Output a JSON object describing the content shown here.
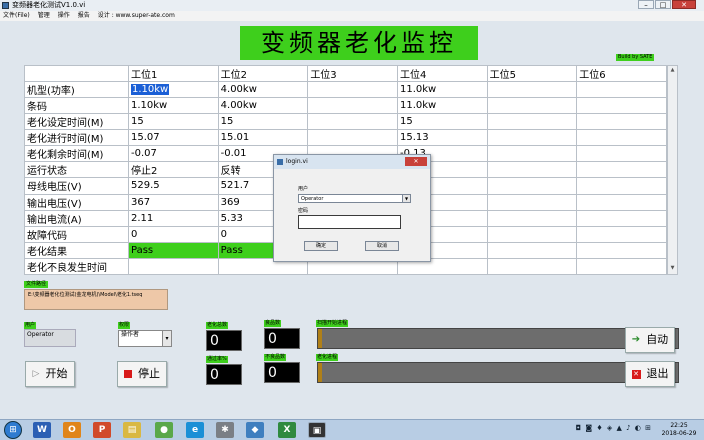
{
  "window": {
    "title": "变频器老化测试V1.0.vi",
    "min": "–",
    "max": "□",
    "close": "✕"
  },
  "menu": [
    "文件(File)",
    "管理",
    "操作",
    "报告",
    "设计 : www.super-ate.com"
  ],
  "main_title": "变频器老化监控",
  "build_badge": "Build by SATE",
  "table": {
    "headers": [
      "",
      "工位1",
      "工位2",
      "工位3",
      "工位4",
      "工位5",
      "工位6"
    ],
    "rows": [
      [
        "机型(功率)",
        "1.10kw",
        "4.00kw",
        "",
        "11.0kw",
        "",
        ""
      ],
      [
        "条码",
        "1.10kw",
        "4.00kw",
        "",
        "11.0kw",
        "",
        ""
      ],
      [
        "老化设定时间(M)",
        "15",
        "15",
        "",
        "15",
        "",
        ""
      ],
      [
        "老化进行时间(M)",
        "15.07",
        "15.01",
        "",
        "15.13",
        "",
        ""
      ],
      [
        "老化剩余时间(M)",
        "-0.07",
        "-0.01",
        "",
        "-0.13",
        "",
        ""
      ],
      [
        "运行状态",
        "停止2",
        "反转",
        "",
        "2",
        "",
        ""
      ],
      [
        "母线电压(V)",
        "529.5",
        "521.7",
        "",
        "9",
        "",
        ""
      ],
      [
        "输出电压(V)",
        "367",
        "369",
        "",
        "",
        "",
        ""
      ],
      [
        "输出电流(A)",
        "2.11",
        "5.33",
        "",
        "",
        "",
        ""
      ],
      [
        "故障代码",
        "0",
        "0",
        "",
        "",
        "",
        ""
      ],
      [
        "老化结果",
        "Pass",
        "Pass",
        "",
        "",
        "",
        ""
      ],
      [
        "老化不良发生时间",
        "",
        "",
        "",
        "",
        "",
        ""
      ]
    ]
  },
  "dialog": {
    "title": "login.vi",
    "close": "✕",
    "user_label": "用户",
    "user_value": "Operator",
    "password_label": "密码",
    "password_value": "",
    "ok_label": "确定",
    "cancel_label": "取消"
  },
  "filepath": {
    "label": "文件路径",
    "value": "E:\\变频器老化位测试(金龙电机)\\Model\\老化1.tseq"
  },
  "user": {
    "label": "用户",
    "value": "Operator"
  },
  "permission": {
    "label": "权限",
    "value": "操作者"
  },
  "counters": {
    "aged_total": {
      "label": "老化总数",
      "value": "0"
    },
    "good": {
      "label": "良品数",
      "value": "0"
    },
    "pass_rate": {
      "label": "通过率%",
      "value": "0"
    },
    "bad": {
      "label": "不良品数",
      "value": "0"
    }
  },
  "progress": {
    "scan": {
      "label": "扫描开始进程",
      "fraction": 0.01
    },
    "aging": {
      "label": "老化进程",
      "fraction": 0.01
    }
  },
  "buttons": {
    "start": "开始",
    "stop": "停止",
    "auto": "自动",
    "exit": "退出"
  },
  "taskbar": {
    "tray": "◘ ◙ ♦ ◈ ▲ ♪ ◐ ⊞",
    "time": "22:25",
    "date": "2018-06-29"
  },
  "colors": {
    "accent_green": "#3ecf1c",
    "selection_blue": "#1a5fd6",
    "stop_red": "#d81a1a"
  }
}
